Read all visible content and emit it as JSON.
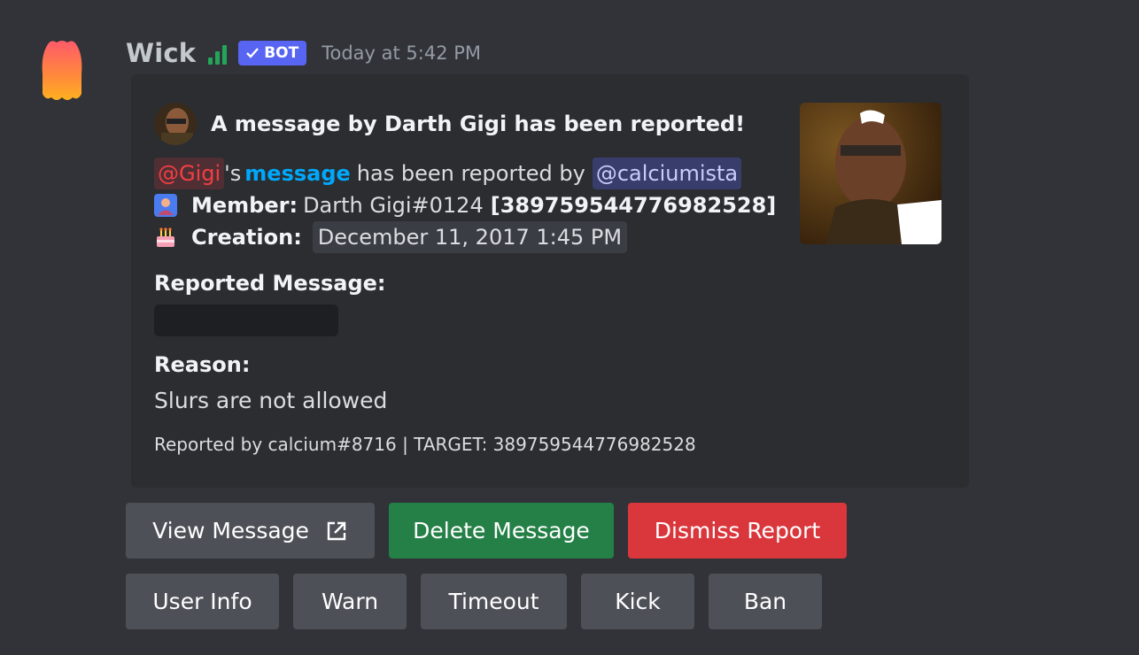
{
  "message": {
    "username": "Wick",
    "bot_tag": "BOT",
    "timestamp": "Today at 5:42 PM"
  },
  "embed": {
    "author": "A message by Darth Gigi has been reported!",
    "mention_reported": "@Gigi",
    "text_possessive": "'s",
    "link_text": "message",
    "text_reported_by": "has been reported by",
    "mention_reporter": "@calciumista",
    "member_label": "Member:",
    "member_value": "Darth Gigi#0124",
    "member_id": "[389759544776982528]",
    "creation_label": "Creation:",
    "creation_value": "December 11, 2017 1:45 PM",
    "reported_message_title": "Reported Message:",
    "reason_title": "Reason:",
    "reason_value": "Slurs are not allowed",
    "footer": "Reported by calcium#8716 | TARGET: 389759544776982528"
  },
  "buttons": {
    "row1": [
      "View Message",
      "Delete Message",
      "Dismiss Report"
    ],
    "row2": [
      "User Info",
      "Warn",
      "Timeout",
      "Kick",
      "Ban"
    ]
  },
  "colors": {
    "background": "#313338",
    "embed": "#2b2d31",
    "bot_tag": "#5865f2",
    "button_grey": "#4e5058",
    "button_green": "#248046",
    "button_red": "#da373c",
    "link": "#00a8fc",
    "signal": "#23a55a"
  },
  "icons": [
    "bot-avatar-icon",
    "signal-icon",
    "checkmark-icon",
    "member-emoji-icon",
    "cake-emoji-icon",
    "external-link-icon"
  ]
}
